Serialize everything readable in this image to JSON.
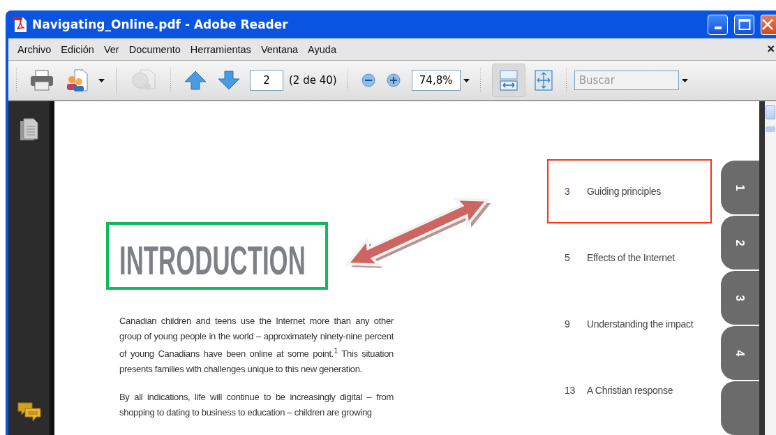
{
  "window": {
    "title": "Navigating_Online.pdf - Adobe Reader"
  },
  "menu": [
    "Archivo",
    "Edición",
    "Ver",
    "Documento",
    "Herramientas",
    "Ventana",
    "Ayuda"
  ],
  "menu_close": "×",
  "toolbar": [
    {
      "kind": "gripper"
    },
    {
      "kind": "print",
      "disabled": false
    },
    {
      "kind": "share",
      "disabled": false
    },
    {
      "kind": "separator"
    },
    {
      "kind": "review",
      "disabled": true
    },
    {
      "kind": "gripper"
    },
    {
      "kind": "prev-page",
      "disabled": false
    },
    {
      "kind": "next-page",
      "disabled": false
    },
    {
      "kind": "page-field",
      "value": "2"
    },
    {
      "kind": "page-count",
      "text": "(2 de 40)"
    },
    {
      "kind": "gripper"
    },
    {
      "kind": "zoom-out",
      "disabled": false
    },
    {
      "kind": "zoom-in",
      "disabled": false
    },
    {
      "kind": "zoom-field",
      "value": "74,8%"
    },
    {
      "kind": "gripper"
    },
    {
      "kind": "fit-width",
      "disabled": false,
      "selected": true
    },
    {
      "kind": "fit-page",
      "disabled": false,
      "selected": false
    },
    {
      "kind": "gripper"
    },
    {
      "kind": "search-field",
      "placeholder": "Buscar"
    }
  ],
  "document": {
    "heading": {
      "text": "INTRODUCTION",
      "highlighted": true
    },
    "paragraphs": [
      "Canadian children and teens use the Internet more than any other group of young people in the world – approximately ninety-nine percent of young Canadians have been online at some point.$^{1}$  This situation presents families with challenges unique to this new generation.",
      "By all indications, life will continue to be increasingly digital – from shopping to dating to business to education – children are growing"
    ],
    "contents": [
      {
        "page": "3",
        "title": "Guiding principles",
        "highlighted": true
      },
      {
        "page": "5",
        "title": "Effects of the Internet",
        "highlighted": false
      },
      {
        "page": "9",
        "title": "Understanding the impact",
        "highlighted": false
      },
      {
        "page": "13",
        "title": "A Christian response",
        "highlighted": false
      }
    ],
    "section_tabs": [
      "1",
      "2",
      "3",
      "4"
    ]
  }
}
